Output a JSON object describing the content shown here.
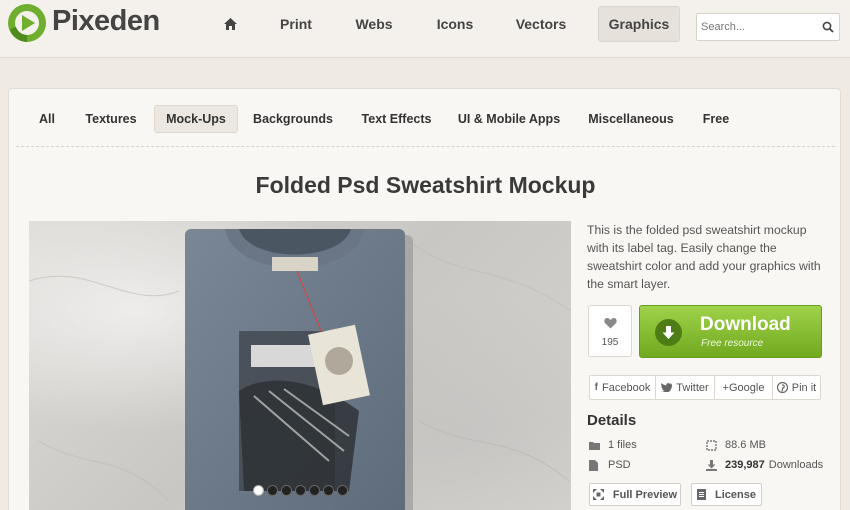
{
  "brand": {
    "name": "Pixeden"
  },
  "nav": {
    "items": [
      {
        "label": "Print"
      },
      {
        "label": "Webs"
      },
      {
        "label": "Icons"
      },
      {
        "label": "Vectors"
      },
      {
        "label": "Graphics"
      }
    ],
    "active": "Graphics"
  },
  "search": {
    "placeholder": "Search..."
  },
  "categories": {
    "items": [
      {
        "label": "All"
      },
      {
        "label": "Textures"
      },
      {
        "label": "Mock-Ups"
      },
      {
        "label": "Backgrounds"
      },
      {
        "label": "Text Effects"
      },
      {
        "label": "UI & Mobile Apps"
      },
      {
        "label": "Miscellaneous"
      },
      {
        "label": "Free"
      }
    ],
    "active": "Mock-Ups"
  },
  "product": {
    "title": "Folded Psd Sweatshirt Mockup",
    "description": "This is the folded psd sweatshirt mockup with its label tag. Easily change the sweatshirt color and add your graphics with the smart layer.",
    "likes": "195",
    "slides": {
      "count": 7,
      "active_index": 0
    }
  },
  "download": {
    "title": "Download",
    "subtitle": "Free resource"
  },
  "share": [
    {
      "label": "Facebook",
      "icon": "facebook-icon"
    },
    {
      "label": "Twitter",
      "icon": "twitter-icon"
    },
    {
      "label": "+Google",
      "icon": "google-plus-icon"
    },
    {
      "label": "Pin it",
      "icon": "pinterest-icon"
    }
  ],
  "details": {
    "heading": "Details",
    "files": "1 files",
    "size": "88.6 MB",
    "format": "PSD",
    "downloads_count": "239,987",
    "downloads_label": "Downloads"
  },
  "actions": {
    "preview": "Full Preview",
    "license": "License"
  },
  "colors": {
    "page_bg": "#efebe4",
    "panel_bg": "#f9f7f3",
    "accent_green": "#8cc43c",
    "logo_green": "#6fae2e"
  }
}
